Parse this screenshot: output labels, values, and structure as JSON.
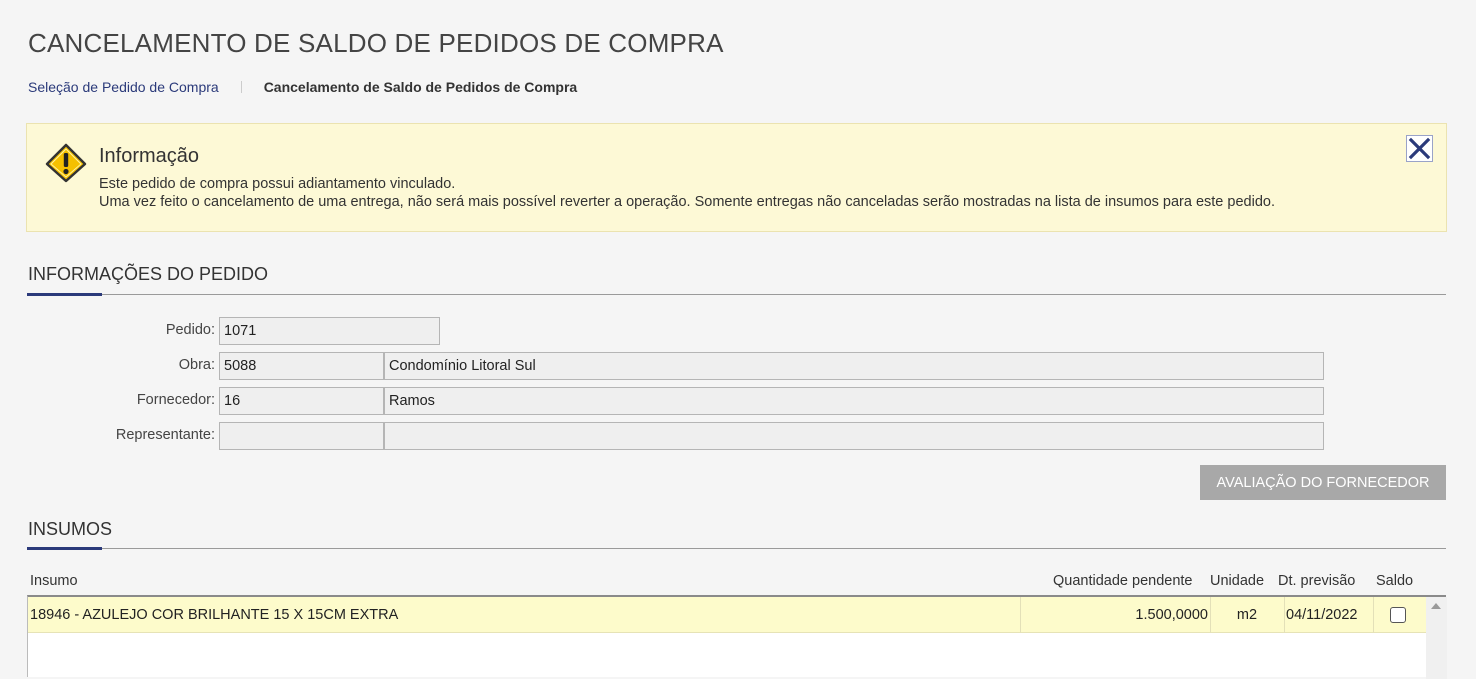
{
  "page": {
    "title": "CANCELAMENTO DE SALDO DE PEDIDOS DE COMPRA"
  },
  "breadcrumb": {
    "link": "Seleção de Pedido de Compra",
    "current": "Cancelamento de Saldo de Pedidos de Compra"
  },
  "info": {
    "icon": "warning-icon",
    "title": "Informação",
    "line1": "Este pedido de compra possui adiantamento vinculado.",
    "line2": "Uma vez feito o cancelamento de uma entrega, não será mais possível reverter a operação. Somente entregas não canceladas serão mostradas na lista de insumos para este pedido.",
    "close_icon": "close-icon"
  },
  "order_section": {
    "title": "INFORMAÇÕES DO PEDIDO",
    "pedido_label": "Pedido:",
    "pedido_value": "1071",
    "obra_label": "Obra:",
    "obra_code": "5088",
    "obra_name": "Condomínio Litoral Sul",
    "fornecedor_label": "Fornecedor:",
    "fornecedor_code": "16",
    "fornecedor_name": "Ramos",
    "representante_label": "Representante:",
    "representante_code": "",
    "representante_name": "",
    "eval_button": "AVALIAÇÃO DO FORNECEDOR"
  },
  "insumos": {
    "title": "INSUMOS",
    "columns": [
      "Insumo",
      "Quantidade pendente",
      "Unidade",
      "Dt. previsão",
      "Saldo"
    ],
    "rows": [
      {
        "insumo": "18946 - AZULEJO COR BRILHANTE 15 X 15CM EXTRA",
        "quantidade": "1.500,0000",
        "unidade": "m2",
        "previsao": "04/11/2022",
        "saldo": false
      }
    ]
  },
  "colors": {
    "accent": "#2b3a7a",
    "info_bg": "#fdf9d6",
    "row_highlight": "#fdfbcb",
    "button_disabled": "#a8a8a8"
  }
}
